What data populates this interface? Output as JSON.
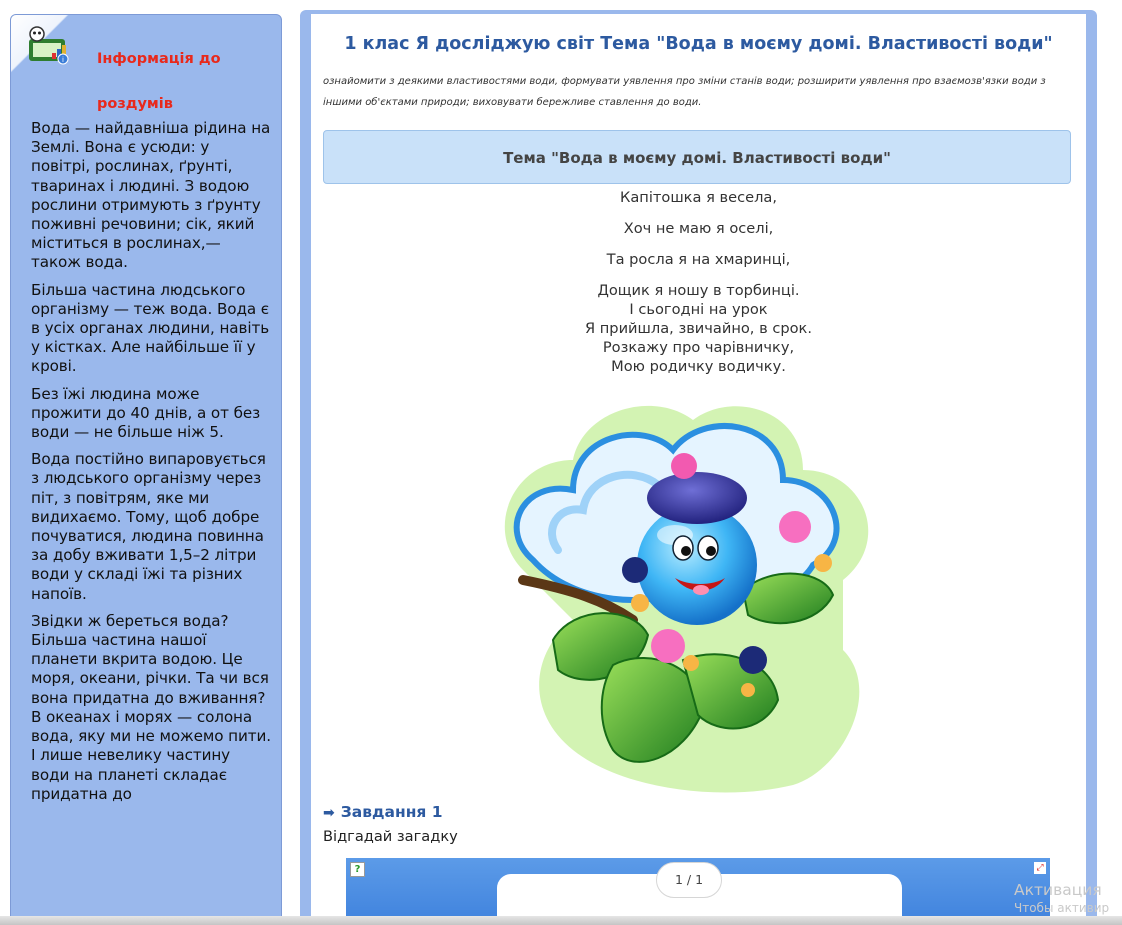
{
  "sidebar": {
    "title": "Інформація до роздумів",
    "paragraphs": [
      "Вода — найдавніша рідина на Землі. Вона є усюди: у повітрі, рослинах, ґрунті, тваринах і людині. З водою рослини отримують з ґрунту поживні речовини; сік, який міститься в рослинах,— також вода.",
      "Більша частина людського організму — теж вода. Вода є в усіх органах людини, навіть у кістках. Але найбільше її у крові.",
      "Без їжі людина може прожити до 40 днів, а от без води — не більше ніж 5.",
      "Вода постійно випаровується з людського організму через піт, з повітрям, яке ми видихаємо. Тому, щоб добре почуватися, людина повинна за добу вживати 1,5–2 літри води у складі їжі та різних напоїв.",
      "Звідки ж береться вода? Більша частина нашої планети вкрита водою. Це моря, океани, річки. Та чи вся вона придатна до вживання? В океанах і морях — солона вода, яку ми не можемо пити. І лише невелику частину води на планеті складає придатна до"
    ]
  },
  "main": {
    "title": "1 клас Я досліджую світ Тема \"Вода в моєму домі. Властивості води\"",
    "description": "ознайомити з деякими властивостями води, формувати уявлення про зміни станів води; розширити уявлення про взаємозв'язки води з іншими об'єктами природи; виховувати бережливе ставлення до води.",
    "topic": "Тема \"Вода в моєму домі. Властивості води\"",
    "poem": [
      "Капітошка я весела,",
      "Хоч не маю я оселі,",
      "Та росла я на хмаринці,",
      "Дощик я ношу в торбинці.",
      "І сьогодні на урок",
      "Я прийшла, звичайно, в срок.",
      "Розкажу про чарівничку,",
      "Мою родичку водичку."
    ],
    "task_title": "Завдання 1",
    "task_text": "Відгадай загадку",
    "widget": {
      "counter": "1 / 1"
    }
  },
  "watermark": {
    "line1": "Активация",
    "line2": "Чтобы активир"
  }
}
